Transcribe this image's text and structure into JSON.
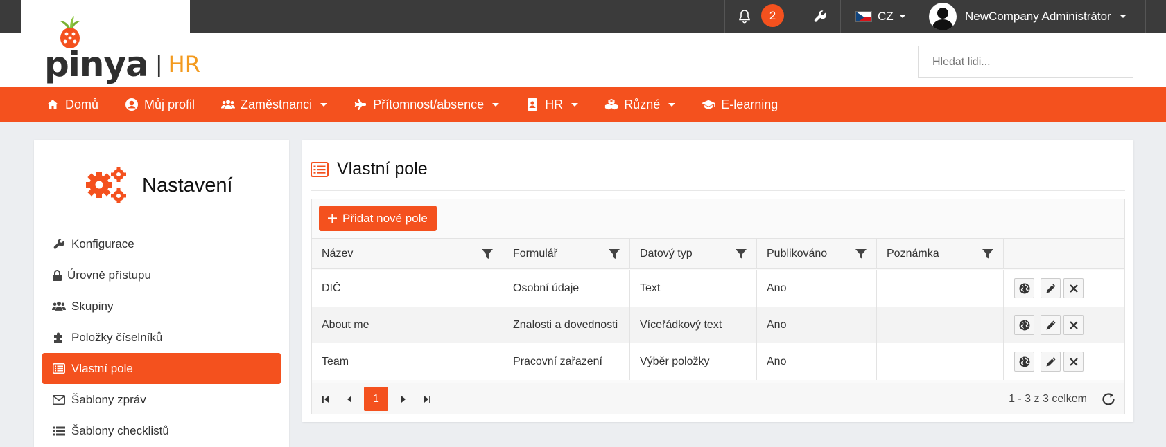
{
  "topbar": {
    "notification_count": "2",
    "language": "CZ",
    "user_name": "NewCompany Administrátor"
  },
  "brand": {
    "logo_text": "pinya",
    "logo_sub": "HR",
    "logo_bar": "|"
  },
  "search": {
    "placeholder": "Hledat lidi..."
  },
  "nav": {
    "items": [
      {
        "label": "Domů",
        "icon": "home-icon"
      },
      {
        "label": "Můj profil",
        "icon": "user-circle-icon"
      },
      {
        "label": "Zaměstnanci",
        "icon": "users-icon"
      },
      {
        "label": "Přítomnost/absence",
        "icon": "plane-icon"
      },
      {
        "label": "HR",
        "icon": "contact-book-icon"
      },
      {
        "label": "Různé",
        "icon": "cubes-icon"
      },
      {
        "label": "E-learning",
        "icon": "graduation-cap-icon"
      }
    ]
  },
  "settings": {
    "title": "Nastavení",
    "menu": [
      {
        "label": "Konfigurace",
        "icon": "wrench-icon"
      },
      {
        "label": "Úrovně přístupu",
        "icon": "lock-icon"
      },
      {
        "label": "Skupiny",
        "icon": "users-icon"
      },
      {
        "label": "Položky číselníků",
        "icon": "puzzle-icon"
      },
      {
        "label": "Vlastní pole",
        "icon": "list-alt-icon"
      },
      {
        "label": "Šablony zpráv",
        "icon": "envelope-icon"
      },
      {
        "label": "Šablony checklistů",
        "icon": "list-icon"
      }
    ]
  },
  "main": {
    "title": "Vlastní pole",
    "add_button": "Přidat nové pole",
    "columns": [
      "Název",
      "Formulář",
      "Datový typ",
      "Publikováno",
      "Poznámka"
    ],
    "rows": [
      {
        "name": "DIČ",
        "form": "Osobní údaje",
        "type": "Text",
        "published": "Ano",
        "note": ""
      },
      {
        "name": "About me",
        "form": "Znalosti a dovednosti",
        "type": "Víceřádkový text",
        "published": "Ano",
        "note": ""
      },
      {
        "name": "Team",
        "form": "Pracovní zařazení",
        "type": "Výběr položky",
        "published": "Ano",
        "note": ""
      }
    ],
    "pager": {
      "current": "1",
      "info": "1 - 3 z 3 celkem"
    }
  },
  "colors": {
    "accent": "#f4511e",
    "topbar": "#3b3b3b",
    "logo_hr": "#f39a1e"
  }
}
